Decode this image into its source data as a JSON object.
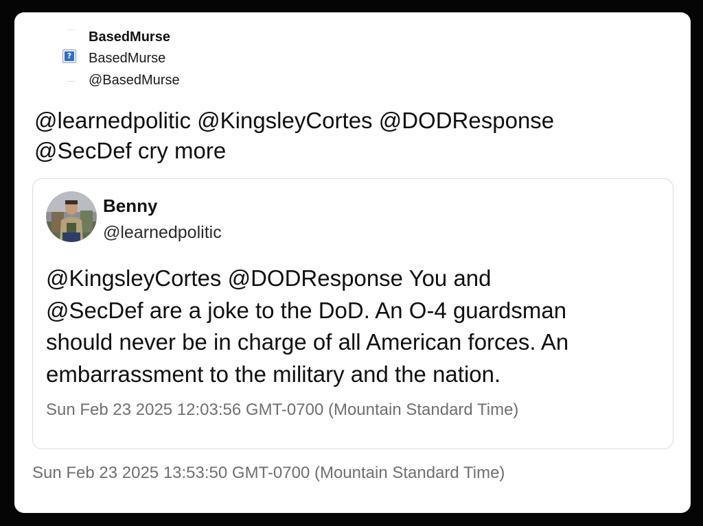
{
  "author": {
    "display_name_bold": "BasedMurse",
    "display_name": "BasedMurse",
    "handle": "@BasedMurse",
    "avatar_icon": "broken-image-icon"
  },
  "tweet": {
    "text_line1": "@learnedpolitic @KingsleyCortes @DODResponse",
    "text_line2": "@SecDef cry more",
    "timestamp": "Sun Feb 23 2025 13:53:50 GMT-0700 (Mountain Standard Time)"
  },
  "quoted_tweet": {
    "name": "Benny",
    "handle": "@learnedpolitic",
    "avatar_icon": "user-photo-avatar",
    "text_line1": "@KingsleyCortes @DODResponse You and",
    "text_line2": "@SecDef are a joke to the DoD. An O-4 guardsman",
    "text_line3": "should never be in charge of all American forces. An",
    "text_line4": "embarrassment to the military and the nation.",
    "timestamp": "Sun Feb 23 2025 12:03:56 GMT-0700 (Mountain Standard Time)"
  },
  "colors": {
    "page_background": "#050505",
    "card_background": "#ffffff",
    "timestamp_text": "#6f6f74",
    "quote_border": "#dcdcdc"
  }
}
